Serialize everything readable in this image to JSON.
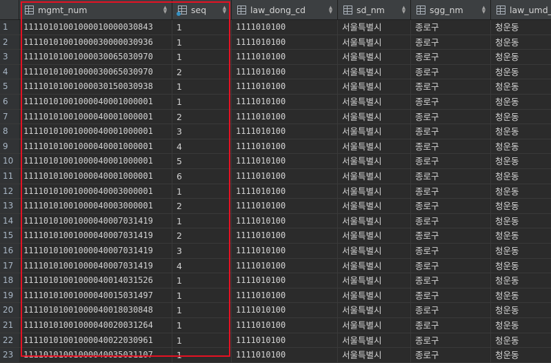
{
  "columns": [
    {
      "name": "mgmt_num",
      "key": false
    },
    {
      "name": "seq",
      "key": true
    },
    {
      "name": "law_dong_cd",
      "key": false
    },
    {
      "name": "sd_nm",
      "key": false
    },
    {
      "name": "sgg_nm",
      "key": false
    },
    {
      "name": "law_umd_",
      "key": false
    }
  ],
  "sort_glyph": "◆",
  "rows": [
    {
      "n": "1",
      "mgmt_num": "11110101001000010000030843",
      "seq": "1",
      "law_dong_cd": "1111010100",
      "sd_nm": "서울특별시",
      "sgg_nm": "종로구",
      "law_umd": "청운동"
    },
    {
      "n": "2",
      "mgmt_num": "11110101001000030000030936",
      "seq": "1",
      "law_dong_cd": "1111010100",
      "sd_nm": "서울특별시",
      "sgg_nm": "종로구",
      "law_umd": "청운동"
    },
    {
      "n": "3",
      "mgmt_num": "11110101001000030065030970",
      "seq": "1",
      "law_dong_cd": "1111010100",
      "sd_nm": "서울특별시",
      "sgg_nm": "종로구",
      "law_umd": "청운동"
    },
    {
      "n": "4",
      "mgmt_num": "11110101001000030065030970",
      "seq": "2",
      "law_dong_cd": "1111010100",
      "sd_nm": "서울특별시",
      "sgg_nm": "종로구",
      "law_umd": "청운동"
    },
    {
      "n": "5",
      "mgmt_num": "11110101001000030150030938",
      "seq": "1",
      "law_dong_cd": "1111010100",
      "sd_nm": "서울특별시",
      "sgg_nm": "종로구",
      "law_umd": "청운동"
    },
    {
      "n": "6",
      "mgmt_num": "11110101001000040001000001",
      "seq": "1",
      "law_dong_cd": "1111010100",
      "sd_nm": "서울특별시",
      "sgg_nm": "종로구",
      "law_umd": "청운동"
    },
    {
      "n": "7",
      "mgmt_num": "11110101001000040001000001",
      "seq": "2",
      "law_dong_cd": "1111010100",
      "sd_nm": "서울특별시",
      "sgg_nm": "종로구",
      "law_umd": "청운동"
    },
    {
      "n": "8",
      "mgmt_num": "11110101001000040001000001",
      "seq": "3",
      "law_dong_cd": "1111010100",
      "sd_nm": "서울특별시",
      "sgg_nm": "종로구",
      "law_umd": "청운동"
    },
    {
      "n": "9",
      "mgmt_num": "11110101001000040001000001",
      "seq": "4",
      "law_dong_cd": "1111010100",
      "sd_nm": "서울특별시",
      "sgg_nm": "종로구",
      "law_umd": "청운동"
    },
    {
      "n": "10",
      "mgmt_num": "11110101001000040001000001",
      "seq": "5",
      "law_dong_cd": "1111010100",
      "sd_nm": "서울특별시",
      "sgg_nm": "종로구",
      "law_umd": "청운동"
    },
    {
      "n": "11",
      "mgmt_num": "11110101001000040001000001",
      "seq": "6",
      "law_dong_cd": "1111010100",
      "sd_nm": "서울특별시",
      "sgg_nm": "종로구",
      "law_umd": "청운동"
    },
    {
      "n": "12",
      "mgmt_num": "11110101001000040003000001",
      "seq": "1",
      "law_dong_cd": "1111010100",
      "sd_nm": "서울특별시",
      "sgg_nm": "종로구",
      "law_umd": "청운동"
    },
    {
      "n": "13",
      "mgmt_num": "11110101001000040003000001",
      "seq": "2",
      "law_dong_cd": "1111010100",
      "sd_nm": "서울특별시",
      "sgg_nm": "종로구",
      "law_umd": "청운동"
    },
    {
      "n": "14",
      "mgmt_num": "11110101001000040007031419",
      "seq": "1",
      "law_dong_cd": "1111010100",
      "sd_nm": "서울특별시",
      "sgg_nm": "종로구",
      "law_umd": "청운동"
    },
    {
      "n": "15",
      "mgmt_num": "11110101001000040007031419",
      "seq": "2",
      "law_dong_cd": "1111010100",
      "sd_nm": "서울특별시",
      "sgg_nm": "종로구",
      "law_umd": "청운동"
    },
    {
      "n": "16",
      "mgmt_num": "11110101001000040007031419",
      "seq": "3",
      "law_dong_cd": "1111010100",
      "sd_nm": "서울특별시",
      "sgg_nm": "종로구",
      "law_umd": "청운동"
    },
    {
      "n": "17",
      "mgmt_num": "11110101001000040007031419",
      "seq": "4",
      "law_dong_cd": "1111010100",
      "sd_nm": "서울특별시",
      "sgg_nm": "종로구",
      "law_umd": "청운동"
    },
    {
      "n": "18",
      "mgmt_num": "11110101001000040014031526",
      "seq": "1",
      "law_dong_cd": "1111010100",
      "sd_nm": "서울특별시",
      "sgg_nm": "종로구",
      "law_umd": "청운동"
    },
    {
      "n": "19",
      "mgmt_num": "11110101001000040015031497",
      "seq": "1",
      "law_dong_cd": "1111010100",
      "sd_nm": "서울특별시",
      "sgg_nm": "종로구",
      "law_umd": "청운동"
    },
    {
      "n": "20",
      "mgmt_num": "11110101001000040018030848",
      "seq": "1",
      "law_dong_cd": "1111010100",
      "sd_nm": "서울특별시",
      "sgg_nm": "종로구",
      "law_umd": "청운동"
    },
    {
      "n": "21",
      "mgmt_num": "11110101001000040020031264",
      "seq": "1",
      "law_dong_cd": "1111010100",
      "sd_nm": "서울특별시",
      "sgg_nm": "종로구",
      "law_umd": "청운동"
    },
    {
      "n": "22",
      "mgmt_num": "11110101001000040022030961",
      "seq": "1",
      "law_dong_cd": "1111010100",
      "sd_nm": "서울특별시",
      "sgg_nm": "종로구",
      "law_umd": "청운동"
    },
    {
      "n": "23",
      "mgmt_num": "11110101001000040035031107",
      "seq": "1",
      "law_dong_cd": "1111010100",
      "sd_nm": "서울특별시",
      "sgg_nm": "종로구",
      "law_umd": "청운동"
    }
  ],
  "colors": {
    "highlight": "#e81123",
    "background": "#2b2b2b",
    "header": "#3c3f41"
  }
}
